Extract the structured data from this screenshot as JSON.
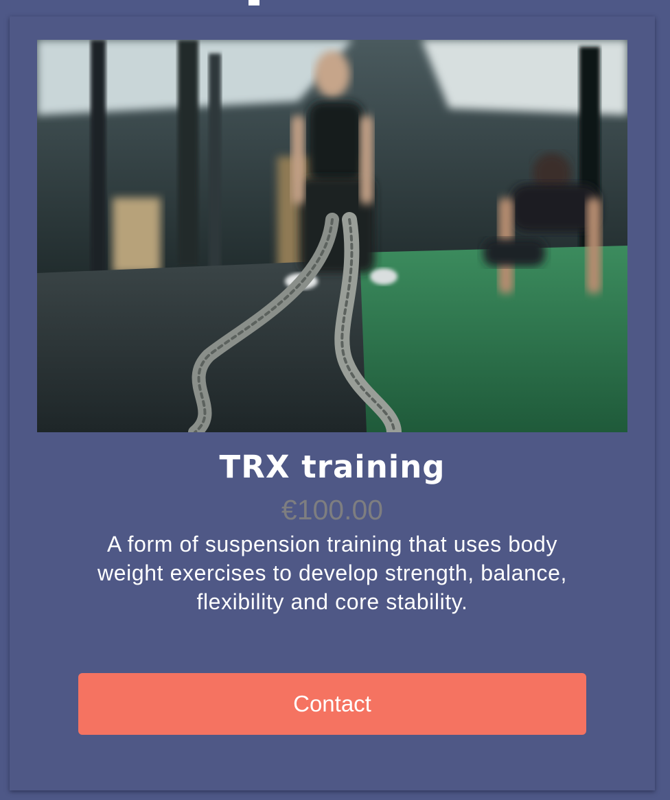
{
  "product": {
    "image_alt": "Two people training in a gym with battle ropes and push-ups",
    "title": "TRX training",
    "price": "€100.00",
    "description": "A form of suspension training that uses body weight exercises to develop strength, balance, flexibility and core stability.",
    "contact_label": "Contact"
  },
  "colors": {
    "page_background": "#4e5887",
    "card_background": "#4f5886",
    "button": "#f57361",
    "price_text": "#7e7e80",
    "text": "#ffffff"
  }
}
